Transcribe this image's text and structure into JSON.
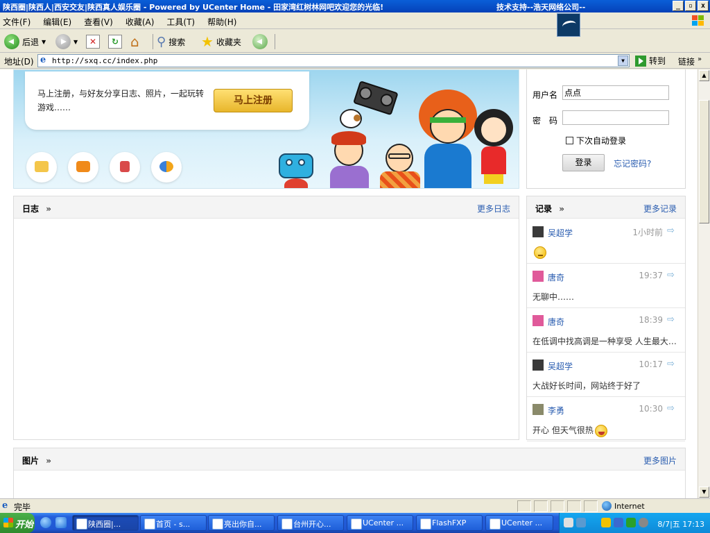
{
  "window": {
    "title": "陕西圈|陕西人|西安交友|陕西真人娱乐圈 - Powered by UCenter Home - 田家湾红树林网吧欢迎您的光临!",
    "support": "技术支持--浩天网络公司--",
    "buttons": [
      "_",
      "▫",
      "x"
    ]
  },
  "menu": {
    "items": [
      "文件(F)",
      "编辑(E)",
      "查看(V)",
      "收藏(A)",
      "工具(T)",
      "帮助(H)"
    ]
  },
  "toolbar": {
    "back_label": "后退",
    "search_label": "搜索",
    "favorites_label": "收藏夹"
  },
  "address": {
    "label": "地址(D)",
    "url": "http://sxq.cc/index.php",
    "go_label": "转到",
    "links_label": "链接"
  },
  "banner": {
    "message": "马上注册，与好友分享日志、照片，一起玩转游戏……",
    "register_button": "马上注册",
    "icons": [
      "blog-icon",
      "camera-icon",
      "card-game-icon",
      "friends-icon"
    ]
  },
  "login": {
    "username_label": "用户名",
    "username_value": "点点",
    "password_label": "密　码",
    "password_value": "",
    "remember_label": "下次自动登录",
    "login_button": "登录",
    "forgot_link": "忘记密码?"
  },
  "blog_panel": {
    "title": "日志",
    "more": "更多日志"
  },
  "records_panel": {
    "title": "记录",
    "more": "更多记录",
    "items": [
      {
        "name": "吴超学",
        "time": "1小时前",
        "text": "",
        "emoji": "sad",
        "avatar_color": "#3a3a3a"
      },
      {
        "name": "唐奇",
        "time": "19:37",
        "text": "无聊中……",
        "emoji": "",
        "avatar_color": "#e05a9a"
      },
      {
        "name": "唐奇",
        "time": "18:39",
        "text": "在低调中找高调是一种享受 人生最大的...",
        "emoji": "",
        "avatar_color": "#e05a9a"
      },
      {
        "name": "吴超学",
        "time": "10:17",
        "text": "大战好长时间，网站终于好了",
        "emoji": "",
        "avatar_color": "#3a3a3a"
      },
      {
        "name": "李勇",
        "time": "10:30",
        "text": "开心 但天气很热",
        "emoji": "big",
        "avatar_color": "#8a8a6a"
      }
    ]
  },
  "photo_panel": {
    "title": "图片",
    "more": "更多图片"
  },
  "status": {
    "text": "完毕",
    "zone": "Internet"
  },
  "taskbar": {
    "start_label": "开始",
    "tasks": [
      "陕西圈|...",
      "首页 - s...",
      "亮出你自...",
      "台州开心...",
      "UCenter ...",
      "FlashFXP",
      "UCenter ..."
    ],
    "clock": "8/7|五  17:13"
  },
  "colors": {
    "link": "#2a5db0",
    "titlebar": "#0a5fd8",
    "register_button": "#e8b62b"
  }
}
